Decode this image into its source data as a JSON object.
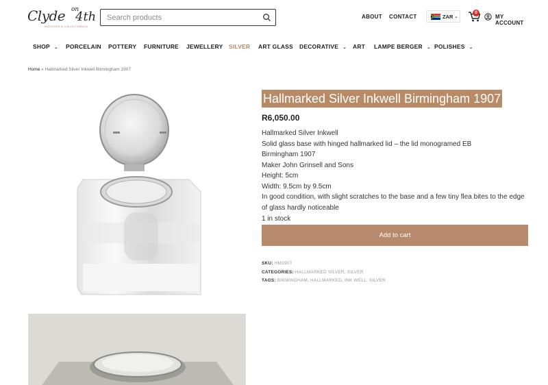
{
  "logo": {
    "main": "Clyde",
    "on": "on",
    "fourth": "4th",
    "tagline": "ANTIQUES & COLLECTABLES"
  },
  "search": {
    "placeholder": "Search products"
  },
  "top_links": {
    "about": "ABOUT",
    "contact": "CONTACT"
  },
  "currency": {
    "code": "ZAR",
    "flag": "south-africa-flag-icon"
  },
  "cart": {
    "count": "0",
    "icon": "cart-icon"
  },
  "account": {
    "label": "MY ACCOUNT",
    "icon": "user-circle-icon"
  },
  "nav": [
    {
      "label": "SHOP",
      "has_dropdown": true
    },
    {
      "label": "PORCELAIN"
    },
    {
      "label": "POTTERY"
    },
    {
      "label": "FURNITURE"
    },
    {
      "label": "JEWELLERY"
    },
    {
      "label": "SILVER",
      "active": true
    },
    {
      "label": "ART GLASS"
    },
    {
      "label": "DECORATIVE",
      "has_dropdown": true
    },
    {
      "label": "ART"
    },
    {
      "label": "LAMPE BERGER",
      "has_dropdown": true
    },
    {
      "label": "POLISHES",
      "has_dropdown": true
    }
  ],
  "breadcrumb": {
    "home": "Home",
    "separator": " » ",
    "current": "Hallmarked Silver Inkwell Birmingham 1907"
  },
  "product": {
    "title": "Hallmarked Silver Inkwell Birmingham 1907",
    "price": "R6,050.00",
    "description": [
      "Hallmarked Silver Inkwell",
      "Solid glass base with hinged hallmarked lid – the lid monogramed EB",
      "Birmingham 1907",
      "Maker John Grinsell and Sons",
      "Height: 5cm",
      "Width: 9.5cm by 9.5cm",
      "In good condition, with slight scratches to the base and a few tiny flea bites to the edge of glass hardly noticeable"
    ],
    "stock": "1 in stock",
    "add_to_cart": "Add to cart",
    "sku_label": "SKU:",
    "sku": "HM1907",
    "categories_label": "CATEGORIES:",
    "categories": "HALLMARKED SILVER, SILVER",
    "tags_label": "TAGS:",
    "tags": "BIRMINGHAM, HALLMARKED, INK WELL, SILVER"
  },
  "colors": {
    "accent": "#b68a66",
    "badge": "#d0312d",
    "text": "#222222"
  }
}
